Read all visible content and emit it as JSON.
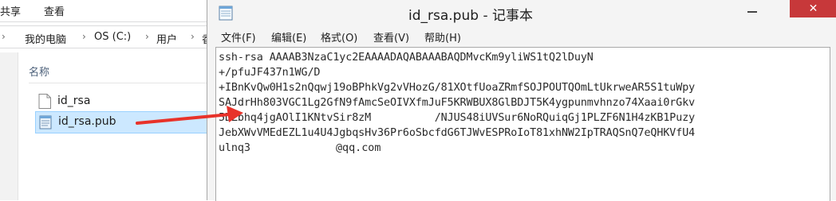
{
  "explorer": {
    "ribbon_tabs": [
      "共享",
      "查看"
    ],
    "address": [
      "我的电脑",
      "OS (C:)",
      "用户",
      "香"
    ],
    "column_header": "名称",
    "files": [
      {
        "name": "id_rsa",
        "icon": "blank-file-icon",
        "selected": false
      },
      {
        "name": "id_rsa.pub",
        "icon": "notepad-file-icon",
        "selected": true
      }
    ]
  },
  "notepad": {
    "title": "id_rsa.pub - 记事本",
    "close_glyph": "✕",
    "menu": [
      "文件(F)",
      "编辑(E)",
      "格式(O)",
      "查看(V)",
      "帮助(H)"
    ],
    "content_lines": [
      "ssh-rsa AAAAB3NzaC1yc2EAAAADAQABAAABAQDMvcKm9yliWS1tQ2lDuyN",
      "+/pfuJF437n1WG/D",
      "+IBnKvQw0H1s2nQqwj19oBPhkVg2vVHozG/81XOtfUoaZRmfSOJPOUTQOmLtUkrweAR5S1tuWpy",
      "SAJdrHh803VGC1Lg2GfN9fAmcSeOIVXfmJuF5KRWBUX8GlBDJT5K4ygpunmvhnzo74Xaai0rGkv",
      "5DZbhq4jgAOlI1KNtvSir8zM          /NJUS48iUVSur6NoRQuiqGj1PLZF6N1H4zKB1Puzy",
      "JebXWvVMEdEZL1u4U4JgbqsHv36Pr6oSbcfdG6TJWvESPRoIoT81xhNW2IpTRAQSnQ7eQHKVfU4",
      "ulnq3"
    ],
    "email_fragment": "@qq.com"
  },
  "colors": {
    "selection": "#cce8ff",
    "close_button": "#c7383a",
    "arrow": "#e8322a"
  }
}
